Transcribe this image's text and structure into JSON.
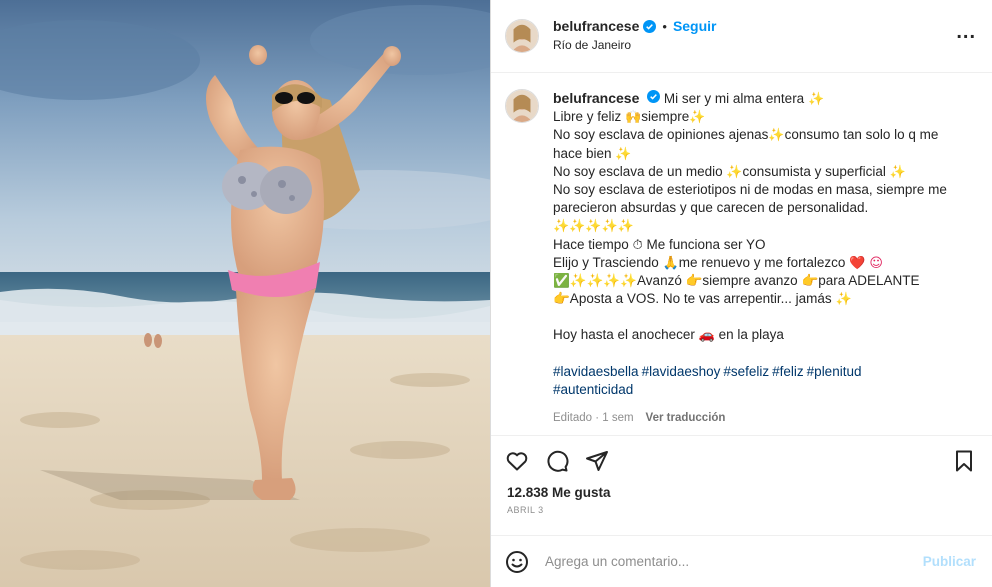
{
  "post": {
    "username": "belufrancese",
    "follow_label": "Seguir",
    "dot": "•",
    "location": "Río de Janeiro",
    "more_label": "...",
    "photo_alt": ""
  },
  "caption": {
    "username": "belufrancese",
    "lines": [
      {
        "text": "Mi ser y mi alma entera",
        "suffix": "✨"
      },
      {
        "text": "Libre y feliz",
        "mid": "🙌",
        "text2": "siempre",
        "suffix": "✨"
      },
      {
        "text": "No soy esclava de opiniones ajenas",
        "mid": "✨",
        "text2": "consumo tan solo lo q me"
      },
      {
        "text": "hace bien",
        "suffix": "✨"
      },
      {
        "text": "No soy esclava de un medio",
        "mid": "✨",
        "text2": "consumista y superficial",
        "suffix": "✨"
      },
      {
        "text": "No soy esclava de esteriotipos ni de modas en masa, siempre me"
      },
      {
        "text": "parecieron absurdas y que carecen de personalidad."
      },
      {
        "text": "",
        "suffix": "✨✨✨✨✨"
      },
      {
        "text": "Hace tiempo",
        "mid": "⏱",
        "text2": "Me funciona ser YO"
      },
      {
        "text": "Elijo y Trasciendo",
        "mid": "🙏",
        "text2": "me renuevo y me fortalezco",
        "suffix": "❤️ ☺"
      },
      {
        "text": "✅✨✨✨✨Avanzó 👉siempre avanzo 👉para ADELANTE"
      },
      {
        "text": "👉Aposta a VOS. No te vas arrepentir... jamás",
        "suffix": "✨"
      }
    ],
    "closing": {
      "text": "Hoy hasta el anochecer",
      "mid": "🚗",
      "text2": "en la playa"
    },
    "hashtags": [
      "#lavidaesbella",
      "#lavidaeshoy",
      "#sefeliz",
      "#feliz",
      "#plenitud",
      "#autenticidad"
    ],
    "edited_label": "Editado · 1 sem",
    "translate_label": "Ver traducción"
  },
  "actions": {
    "like_icon": "heart-outline-icon",
    "comment_icon": "comment-bubble-icon",
    "share_icon": "paper-plane-icon",
    "save_icon": "bookmark-icon"
  },
  "stats": {
    "likes": "12.838 Me gusta",
    "date": "ABRIL 3"
  },
  "comment_box": {
    "placeholder": "Agrega un comentario...",
    "publish_label": "Publicar"
  },
  "colors": {
    "accent_blue": "#0095f6",
    "hashtag": "#00376b",
    "muted": "#8e8e8e",
    "publish_disabled": "#b2dffc"
  }
}
